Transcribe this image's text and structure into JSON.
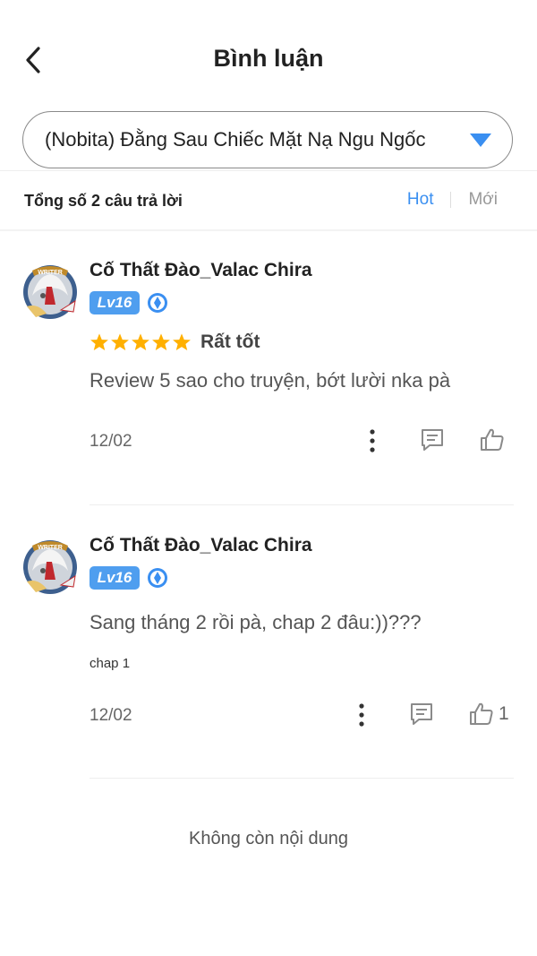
{
  "header": {
    "title": "Bình luận",
    "back_icon": "chevron-left-icon"
  },
  "story_select": {
    "value": "(Nobita) Đằng Sau Chiếc Mặt Nạ Ngu Ngốc",
    "caret_icon": "triangle-down-icon",
    "caret_color": "#3a8ff1"
  },
  "summary": {
    "total_text": "Tổng số 2 câu trả lời",
    "sort_tabs": [
      {
        "label": "Hot",
        "active": true
      },
      {
        "label": "Mới",
        "active": false
      }
    ]
  },
  "colors": {
    "accent": "#3a8ff1",
    "level_badge": "#4f9eef",
    "star": "#ffb000"
  },
  "comments": [
    {
      "username": "Cố Thất Đào_Valac Chira",
      "level": "Lv16",
      "rating": 5,
      "rating_text": "Rất tốt",
      "text": "Review 5 sao cho truyện, bớt lười nka pà",
      "chapter": "",
      "date": "12/02",
      "likes": ""
    },
    {
      "username": "Cố Thất Đào_Valac Chira",
      "level": "Lv16",
      "rating": null,
      "rating_text": "",
      "text": "Sang tháng 2 rồi pà, chap 2 đâu:))???",
      "chapter": "chap 1",
      "date": "12/02",
      "likes": "1"
    }
  ],
  "footer": {
    "end_text": "Không còn nội dung"
  }
}
